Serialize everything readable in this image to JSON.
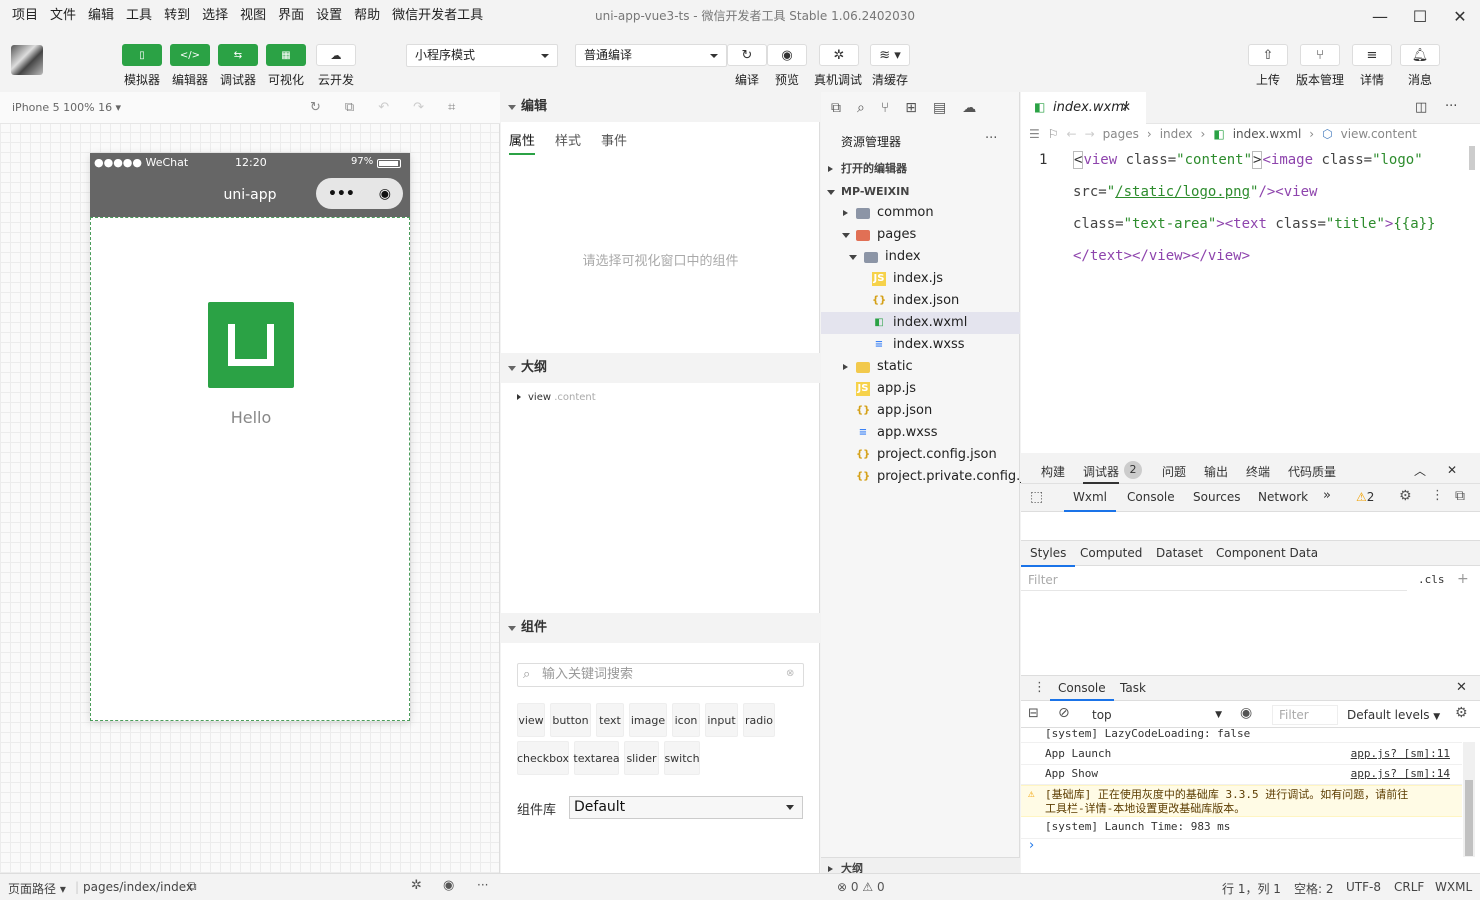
{
  "menubar": {
    "items": [
      "项目",
      "文件",
      "编辑",
      "工具",
      "转到",
      "选择",
      "视图",
      "界面",
      "设置",
      "帮助",
      "微信开发者工具"
    ],
    "window_title": "uni-app-vue3-ts - 微信开发者工具 Stable 1.06.2402030"
  },
  "toolbar": {
    "simulator": "模拟器",
    "editor": "编辑器",
    "debugger": "调试器",
    "visual": "可视化",
    "cloud": "云开发",
    "mode_select": "小程序模式",
    "compile_select": "普通编译",
    "compile": "编译",
    "preview": "预览",
    "real_debug": "真机调试",
    "clear_cache": "清缓存",
    "upload": "上传",
    "version": "版本管理",
    "details": "详情",
    "messages": "消息"
  },
  "simulator": {
    "device": "iPhone 5 100% 16 ▾",
    "status_carrier": "●●●●● WeChat",
    "status_time": "12:20",
    "status_battery": "97%",
    "nav_title": "uni-app",
    "hello": "Hello"
  },
  "bottombar": {
    "page_path_label": "页面路径 ▾",
    "page_path": "pages/index/index",
    "cursor": "行 1，列 1",
    "spaces": "空格: 2",
    "encoding": "UTF-8",
    "eol": "CRLF",
    "lang": "WXML",
    "errors": "0",
    "warnings": "0"
  },
  "inspector": {
    "edit_header": "编辑",
    "tabs": [
      "属性",
      "样式",
      "事件"
    ],
    "empty_hint": "请选择可视化窗口中的组件",
    "outline_header": "大纲",
    "outline_item": "view",
    "outline_class": ".content",
    "components_header": "组件",
    "search_placeholder": "输入关键词搜索",
    "chips": [
      "view",
      "button",
      "text",
      "image",
      "icon",
      "input",
      "radio",
      "checkbox",
      "textarea",
      "slider",
      "switch"
    ],
    "library_label": "组件库",
    "library_value": "Default"
  },
  "explorer": {
    "title": "资源管理器",
    "open_editors": "打开的编辑器",
    "root": "MP-WEIXIN",
    "items": {
      "common": "common",
      "pages": "pages",
      "index": "index",
      "index_js": "index.js",
      "index_json": "index.json",
      "index_wxml": "index.wxml",
      "index_wxss": "index.wxss",
      "static": "static",
      "app_js": "app.js",
      "app_json": "app.json",
      "app_wxss": "app.wxss",
      "project_config": "project.config.json",
      "project_private": "project.private.config.js..."
    },
    "outline_footer": "大纲"
  },
  "editor": {
    "tab": "index.wxml",
    "breadcrumb": [
      "pages",
      "index",
      "index.wxml",
      "view.content"
    ],
    "line_number": "1"
  },
  "devtools": {
    "top_tabs": [
      "构建",
      "调试器",
      "问题",
      "输出",
      "终端",
      "代码质量"
    ],
    "debugger_badge": "2",
    "panel_tabs": [
      "Wxml",
      "Console",
      "Sources",
      "Network"
    ],
    "warn_count": "2",
    "style_tabs": [
      "Styles",
      "Computed",
      "Dataset",
      "Component Data"
    ],
    "filter_placeholder": "Filter",
    "cls": ".cls",
    "drawer_tabs": [
      "Console",
      "Task"
    ],
    "context": "top",
    "console_filter": "Filter",
    "levels": "Default levels",
    "logs": [
      {
        "text": "[system] LazyCodeLoading: false",
        "link": ""
      },
      {
        "text": "App Launch",
        "link": "app.js? [sm]:11"
      },
      {
        "text": "App Show",
        "link": "app.js? [sm]:14"
      },
      {
        "text": "[基础库] 正在使用灰度中的基础库 3.3.5 进行调试。如有问题，请前往\n工具栏-详情-本地设置更改基础库版本。",
        "link": ""
      },
      {
        "text": "[system] Launch Time: 983 ms",
        "link": ""
      }
    ]
  }
}
